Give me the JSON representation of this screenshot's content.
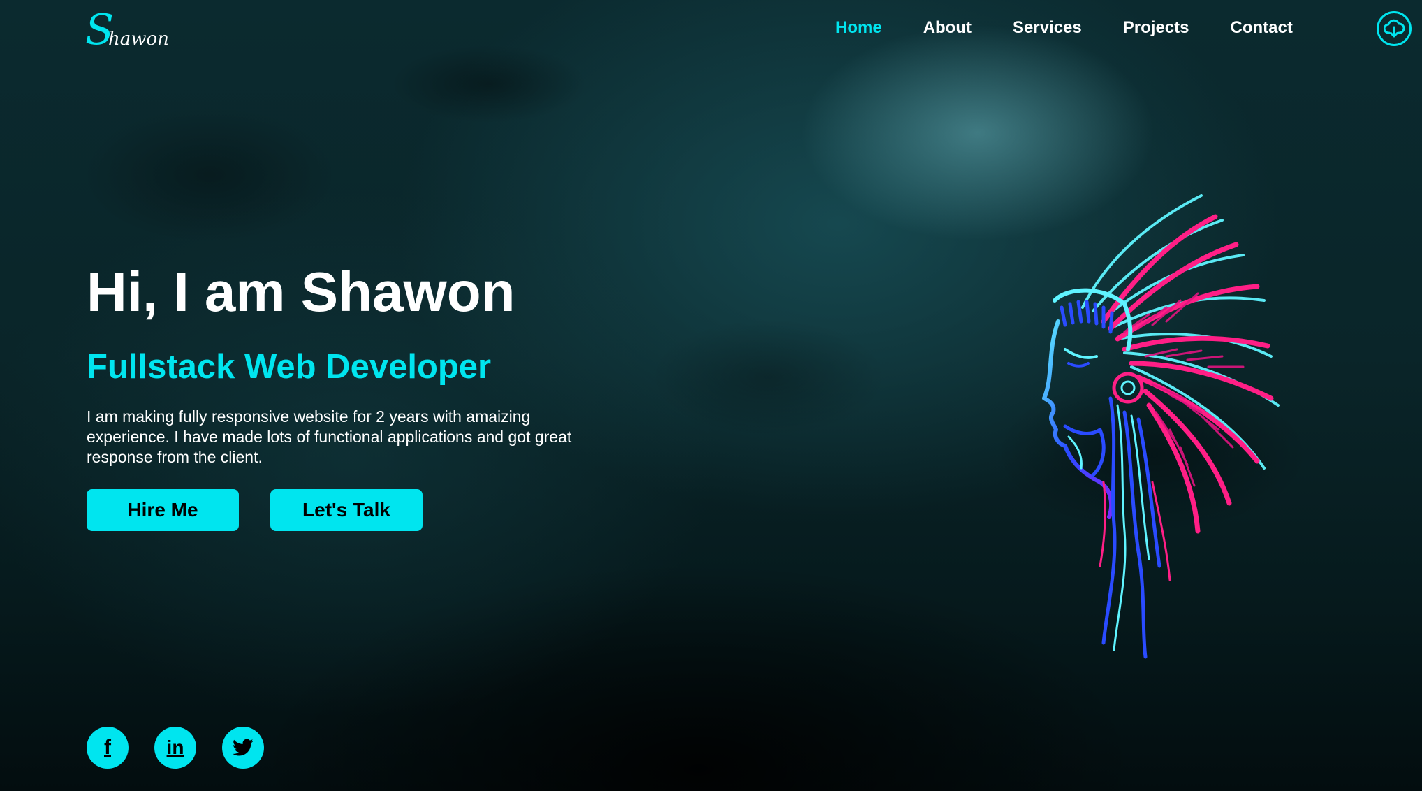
{
  "brand": {
    "logo_initial": "S",
    "logo_rest": "hawon"
  },
  "nav": {
    "items": [
      {
        "label": "Home",
        "active": true
      },
      {
        "label": "About",
        "active": false
      },
      {
        "label": "Services",
        "active": false
      },
      {
        "label": "Projects",
        "active": false
      },
      {
        "label": "Contact",
        "active": false
      }
    ],
    "download_icon": "cloud-download-icon"
  },
  "hero": {
    "title": "Hi, I am Shawon",
    "subtitle": "Fullstack Web Developer",
    "description": "I am making fully responsive website for 2 years with amaizing experience. I have made lots of functional applications and got great response from the client.",
    "buttons": {
      "hire": "Hire Me",
      "talk": "Let's Talk"
    }
  },
  "socials": [
    {
      "name": "facebook",
      "glyph": "f"
    },
    {
      "name": "linkedin",
      "glyph": "in"
    },
    {
      "name": "twitter",
      "glyph": "twitter-bird"
    }
  ],
  "colors": {
    "accent": "#00e5ef",
    "text": "#ffffff",
    "background": "#0a2529",
    "portrait_pink": "#ff1f86",
    "portrait_blue": "#2a4bff",
    "portrait_cyan": "#5ff4ff"
  }
}
